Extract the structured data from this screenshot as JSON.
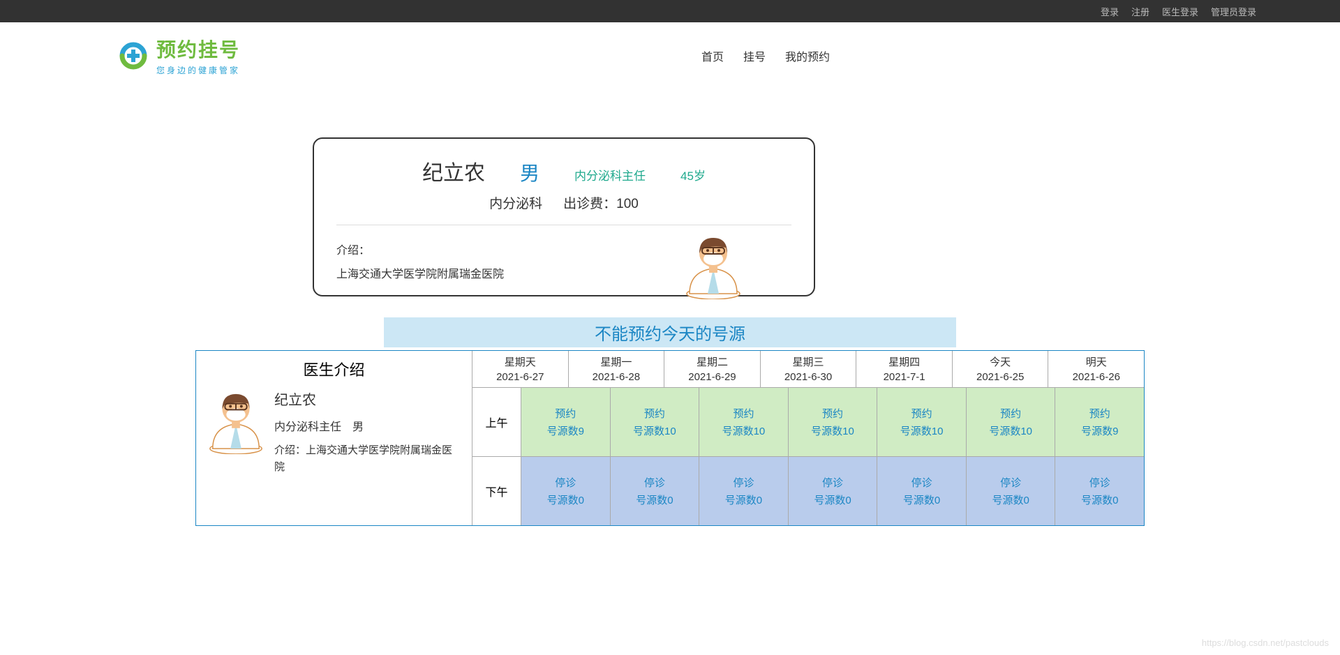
{
  "topbar": {
    "login": "登录",
    "register": "注册",
    "doctor_login": "医生登录",
    "admin_login": "管理员登录"
  },
  "logo": {
    "title": "预约挂号",
    "subtitle": "您身边的健康管家"
  },
  "nav": {
    "home": "首页",
    "register": "挂号",
    "my": "我的预约"
  },
  "doctor": {
    "name": "纪立农",
    "gender": "男",
    "title": "内分泌科主任",
    "age": "45岁",
    "department": "内分泌科",
    "fee_label": "出诊费：",
    "fee_value": "100",
    "intro_label": "介绍：",
    "intro_text": "上海交通大学医学院附属瑞金医院"
  },
  "notice": "不能预约今天的号源",
  "intro_header": "医生介绍",
  "side_intro": {
    "name": "纪立农",
    "title": "内分泌科主任",
    "gender": "男",
    "desc": "介绍：上海交通大学医学院附属瑞金医院"
  },
  "period_am": "上午",
  "period_pm": "下午",
  "days": [
    {
      "label": "星期天",
      "date": "2021-6-27"
    },
    {
      "label": "星期一",
      "date": "2021-6-28"
    },
    {
      "label": "星期二",
      "date": "2021-6-29"
    },
    {
      "label": "星期三",
      "date": "2021-6-30"
    },
    {
      "label": "星期四",
      "date": "2021-7-1"
    },
    {
      "label": "今天",
      "date": "2021-6-25"
    },
    {
      "label": "明天",
      "date": "2021-6-26"
    }
  ],
  "am_slots": [
    {
      "status": "预约",
      "count": "号源数9"
    },
    {
      "status": "预约",
      "count": "号源数10"
    },
    {
      "status": "预约",
      "count": "号源数10"
    },
    {
      "status": "预约",
      "count": "号源数10"
    },
    {
      "status": "预约",
      "count": "号源数10"
    },
    {
      "status": "预约",
      "count": "号源数10"
    },
    {
      "status": "预约",
      "count": "号源数9"
    }
  ],
  "pm_slots": [
    {
      "status": "停诊",
      "count": "号源数0"
    },
    {
      "status": "停诊",
      "count": "号源数0"
    },
    {
      "status": "停诊",
      "count": "号源数0"
    },
    {
      "status": "停诊",
      "count": "号源数0"
    },
    {
      "status": "停诊",
      "count": "号源数0"
    },
    {
      "status": "停诊",
      "count": "号源数0"
    },
    {
      "status": "停诊",
      "count": "号源数0"
    }
  ],
  "watermark": "https://blog.csdn.net/pastclouds"
}
